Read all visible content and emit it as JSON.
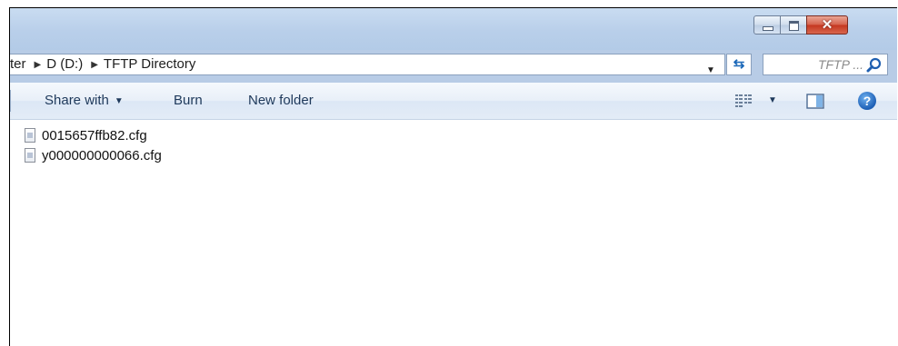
{
  "address": {
    "crumbs": [
      "ter",
      "D (D:)",
      "TFTP Directory"
    ]
  },
  "search": {
    "placeholder": "TFTP ..."
  },
  "toolbar": {
    "share_label": "Share with",
    "burn_label": "Burn",
    "new_folder_label": "New folder"
  },
  "files": [
    {
      "name": "0015657ffb82.cfg"
    },
    {
      "name": "y000000000066.cfg"
    }
  ],
  "icons": {
    "refresh": "refresh-icon",
    "search": "search-icon",
    "views": "views-icon",
    "preview": "preview-pane-icon",
    "help": "help-icon",
    "file": "cfg-file-icon"
  },
  "colors": {
    "titlebar": "#c9dcf1",
    "toolbar": "#e8eff8",
    "close_button": "#c4361f",
    "link_text": "#1e395b"
  }
}
